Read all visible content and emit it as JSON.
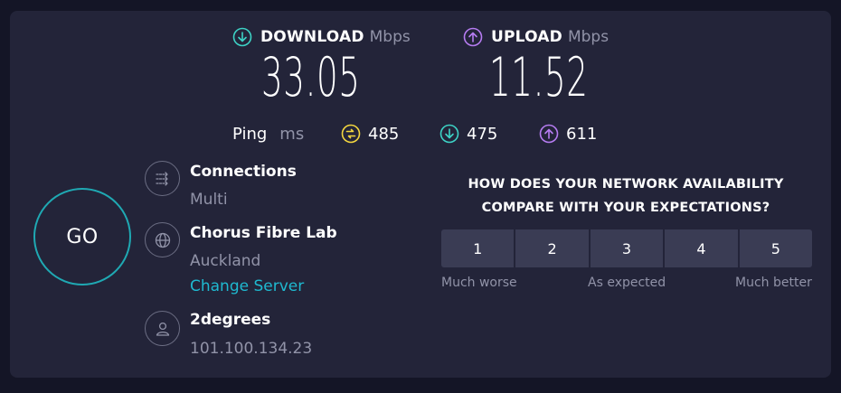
{
  "download": {
    "label": "DOWNLOAD",
    "unit": "Mbps",
    "value": "33.05"
  },
  "upload": {
    "label": "UPLOAD",
    "unit": "Mbps",
    "value": "11.52"
  },
  "ping": {
    "label": "Ping",
    "unit": "ms",
    "idle": "485",
    "down": "475",
    "up": "611"
  },
  "go_label": "GO",
  "connections": {
    "title": "Connections",
    "value": "Multi"
  },
  "server": {
    "title": "Chorus Fibre Lab",
    "location": "Auckland",
    "change": "Change Server"
  },
  "provider": {
    "title": "2degrees",
    "ip": "101.100.134.23"
  },
  "survey": {
    "line1": "HOW DOES YOUR NETWORK AVAILABILITY",
    "line2": "COMPARE WITH YOUR EXPECTATIONS?",
    "options": [
      "1",
      "2",
      "3",
      "4",
      "5"
    ],
    "low": "Much worse",
    "mid": "As expected",
    "high": "Much better"
  },
  "colors": {
    "download": "#3dd3c6",
    "upload": "#b67cf2",
    "ping_idle": "#f4d73f",
    "accent": "#1fa9b3",
    "link": "#1fb9d0"
  }
}
